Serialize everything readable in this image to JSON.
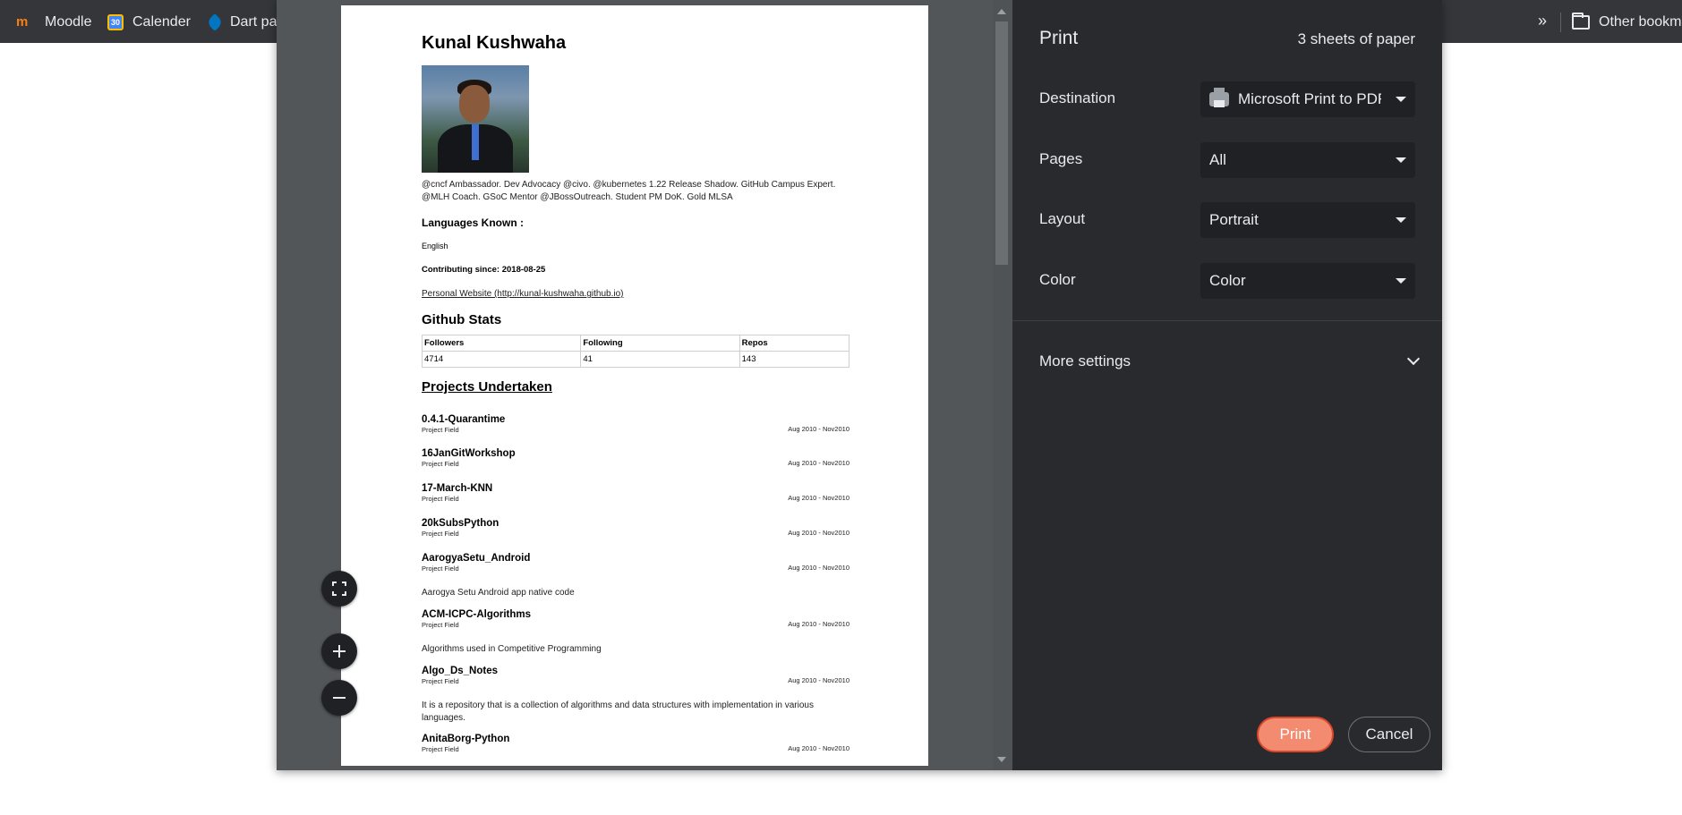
{
  "bookmarks": {
    "items": [
      {
        "label": "Moodle",
        "icon": "moodle-icon"
      },
      {
        "label": "Calender",
        "icon": "calendar-icon",
        "icon_text": "30"
      },
      {
        "label": "Dart pa",
        "icon": "dart-icon"
      }
    ],
    "overflow": "»",
    "other": "Other bookma"
  },
  "preview": {
    "name": "Kunal Kushwaha",
    "bio": "@cncf Ambassador. Dev Advocacy @civo. @kubernetes 1.22 Release Shadow. GitHub Campus Expert. @MLH Coach. GSoC Mentor @JBossOutreach. Student PM DoK. Gold MLSA",
    "languages_heading": "Languages Known :",
    "language": "English",
    "contributing": "Contributing since: 2018-08-25",
    "website": "Personal Website (http://kunal-kushwaha.github.io)",
    "github_stats_heading": "Github Stats",
    "stats": {
      "headers": [
        "Followers",
        "Following",
        "Repos"
      ],
      "values": [
        "4714",
        "41",
        "143"
      ]
    },
    "projects_heading": "Projects Undertaken",
    "projects": [
      {
        "name": "0.4.1-Quarantime",
        "field": "Project Field",
        "date": "Aug 2010 - Nov2010"
      },
      {
        "name": "16JanGitWorkshop",
        "field": "Project Field",
        "date": "Aug 2010 - Nov2010"
      },
      {
        "name": "17-March-KNN",
        "field": "Project Field",
        "date": "Aug 2010 - Nov2010"
      },
      {
        "name": "20kSubsPython",
        "field": "Project Field",
        "date": "Aug 2010 - Nov2010"
      },
      {
        "name": "AarogyaSetu_Android",
        "field": "Project Field",
        "date": "Aug 2010 - Nov2010",
        "desc": "Aarogya Setu Android app native code"
      },
      {
        "name": "ACM-ICPC-Algorithms",
        "field": "Project Field",
        "date": "Aug 2010 - Nov2010",
        "desc": "Algorithms used in Competitive Programming"
      },
      {
        "name": "Algo_Ds_Notes",
        "field": "Project Field",
        "date": "Aug 2010 - Nov2010",
        "desc": "It is a repository that is a collection of algorithms and data structures with implementation in various languages."
      },
      {
        "name": "AnitaBorg-Python",
        "field": "Project Field",
        "date": "Aug 2010 - Nov2010"
      }
    ]
  },
  "settings": {
    "title": "Print",
    "sheets": "3 sheets of paper",
    "destination_label": "Destination",
    "destination_value": "Microsoft Print to PDF",
    "pages_label": "Pages",
    "pages_value": "All",
    "layout_label": "Layout",
    "layout_value": "Portrait",
    "color_label": "Color",
    "color_value": "Color",
    "more_settings": "More settings",
    "print_button": "Print",
    "cancel_button": "Cancel"
  },
  "colors": {
    "accent": "#f28b6f",
    "panel_bg": "#292a2d",
    "preview_bg": "#525659",
    "bookmarks_bg": "#35363a"
  }
}
